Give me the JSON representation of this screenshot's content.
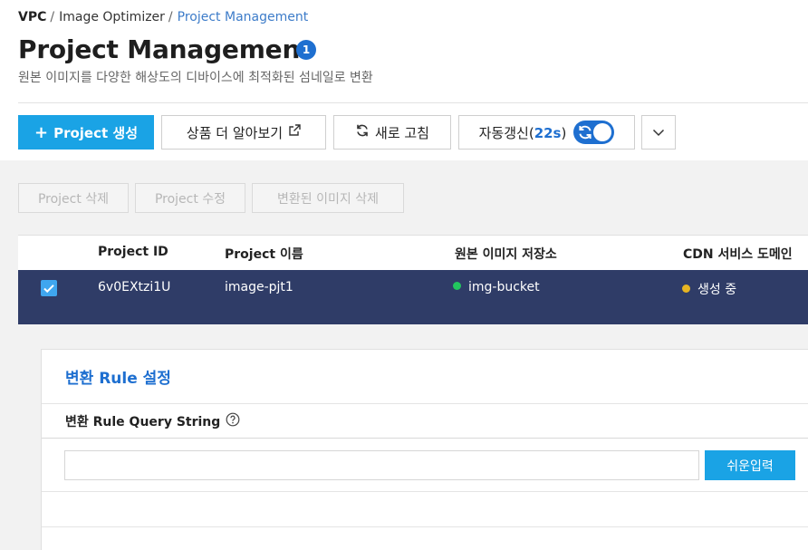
{
  "breadcrumb": {
    "items": [
      "VPC",
      "Image Optimizer",
      "Project Management"
    ],
    "separator": "/"
  },
  "page": {
    "title": "Project Management",
    "badge_count": "1",
    "description": "원본 이미지를 다양한 해상도의 디바이스에 최적화된 섬네일로 변환"
  },
  "toolbar": {
    "create_plus": "+",
    "create_label": "Project 생성",
    "learn_more_label": "상품 더 알아보기",
    "refresh_label": "새로 고침",
    "auto_refresh_label": "자동갱신(",
    "auto_refresh_count": "22s",
    "auto_refresh_close": ")",
    "auto_refresh_on": true
  },
  "actions": {
    "delete_project": "Project 삭제",
    "edit_project": "Project 수정",
    "delete_images": "변환된 이미지 삭제"
  },
  "table": {
    "columns": [
      "Project ID",
      "Project 이름",
      "원본 이미지 저장소",
      "CDN 서비스 도메인"
    ],
    "rows": [
      {
        "selected": true,
        "project_id": "6v0EXtzi1U",
        "project_name": "image-pjt1",
        "storage": "img-bucket",
        "storage_status_color": "#22c55e",
        "cdn_status": "생성 중",
        "cdn_status_color": "#e6b422"
      }
    ]
  },
  "rule_panel": {
    "title": "변환 Rule 설정",
    "query_label": "변환 Rule Query String",
    "query_value": "",
    "easy_input_label": "쉬운입력"
  },
  "colors": {
    "accent": "#1aa3e5",
    "brand_blue": "#1e6fd0",
    "selected_row": "#2f3c67"
  }
}
